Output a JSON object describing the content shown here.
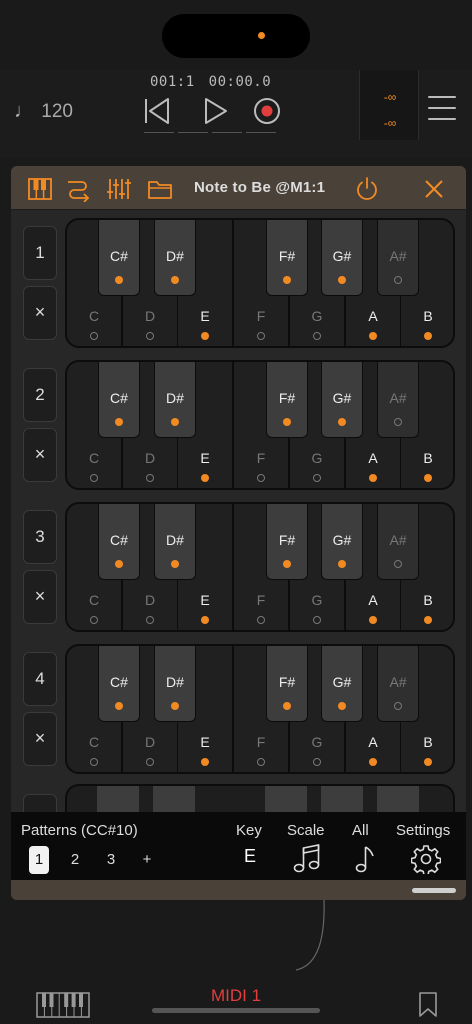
{
  "transport": {
    "tempo": "120",
    "bars": "001:1",
    "time": "00:00.0",
    "meter_top": "-∞",
    "meter_bottom": "-∞"
  },
  "panel": {
    "title": "Note to Be @M1:1",
    "header_icons": [
      "piano-icon",
      "routing-icon",
      "mixer-icon",
      "folder-icon",
      "power-icon",
      "close-icon"
    ]
  },
  "colors": {
    "accent": "#f28a24",
    "header_bg": "#4a4238",
    "midi_label": "#e13f3f"
  },
  "rows": [
    {
      "number": "1",
      "clear": "×"
    },
    {
      "number": "2",
      "clear": "×"
    },
    {
      "number": "3",
      "clear": "×"
    },
    {
      "number": "4",
      "clear": "×"
    }
  ],
  "keys": {
    "white": [
      {
        "label": "C",
        "on": false
      },
      {
        "label": "D",
        "on": false
      },
      {
        "label": "E",
        "on": true
      },
      {
        "label": "F",
        "on": false
      },
      {
        "label": "G",
        "on": false
      },
      {
        "label": "A",
        "on": true
      },
      {
        "label": "B",
        "on": true
      }
    ],
    "black": [
      {
        "label": "C#",
        "on": true
      },
      {
        "label": "D#",
        "on": true
      },
      {
        "label": "F#",
        "on": true
      },
      {
        "label": "G#",
        "on": true
      },
      {
        "label": "A#",
        "on": false
      }
    ]
  },
  "toolbar": {
    "patterns_label": "Patterns (CC#10)",
    "patterns": [
      "1",
      "2",
      "3",
      "+"
    ],
    "active_pattern": "1",
    "key_label": "Key",
    "key_value": "E",
    "scale_label": "Scale",
    "all_label": "All",
    "settings_label": "Settings"
  },
  "bottom": {
    "midi_label": "MIDI 1"
  }
}
